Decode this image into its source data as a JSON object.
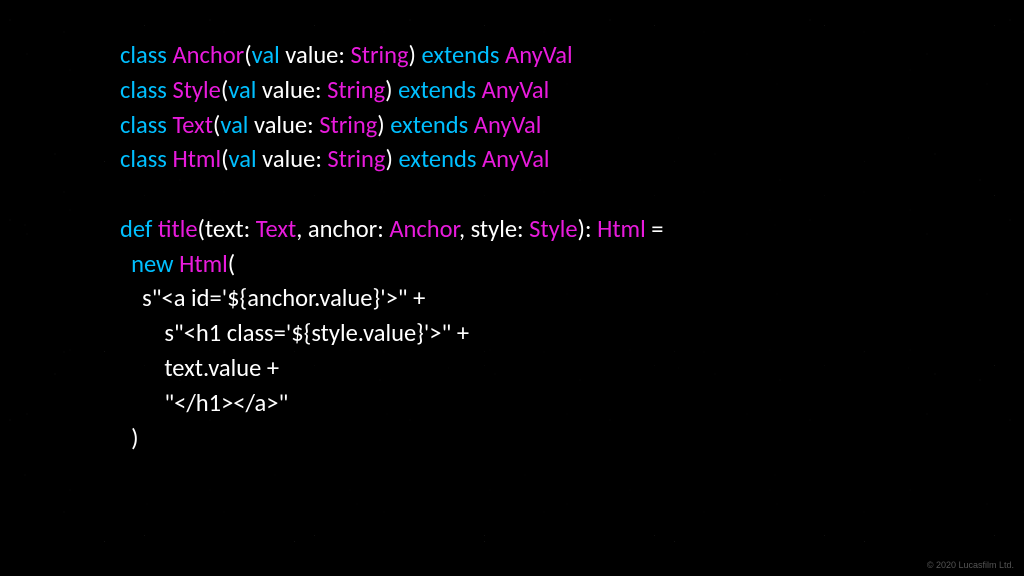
{
  "colors": {
    "keyword": "#00bfff",
    "typename": "#e81bdc",
    "identifier": "#ffffff",
    "background": "#000000"
  },
  "kw": {
    "class": "class",
    "val": "val",
    "extends": "extends",
    "def": "def",
    "new": "new"
  },
  "types": {
    "Anchor": "Anchor",
    "Style": "Style",
    "Text": "Text",
    "Html": "Html",
    "String": "String",
    "AnyVal": "AnyVal"
  },
  "idents": {
    "value": "value",
    "text": "text",
    "anchor": "anchor",
    "style": "style",
    "title": "title"
  },
  "punct": {
    "lparen": "(",
    "rparen": ")",
    "colon_sp": ": ",
    "comma_sp": ", ",
    "eq": " =",
    "space": " ",
    "indent1": "  ",
    "indent2": "    ",
    "indent3": "        ",
    "plus": " +"
  },
  "strings": {
    "s1": "s\"<a id='${anchor.value}'>\"",
    "s2": "s\"<h1 class='${style.value}'>\"",
    "s3": "text.value",
    "s4": "\"</h1></a>\""
  },
  "footer": "© 2020 Lucasfilm Ltd."
}
